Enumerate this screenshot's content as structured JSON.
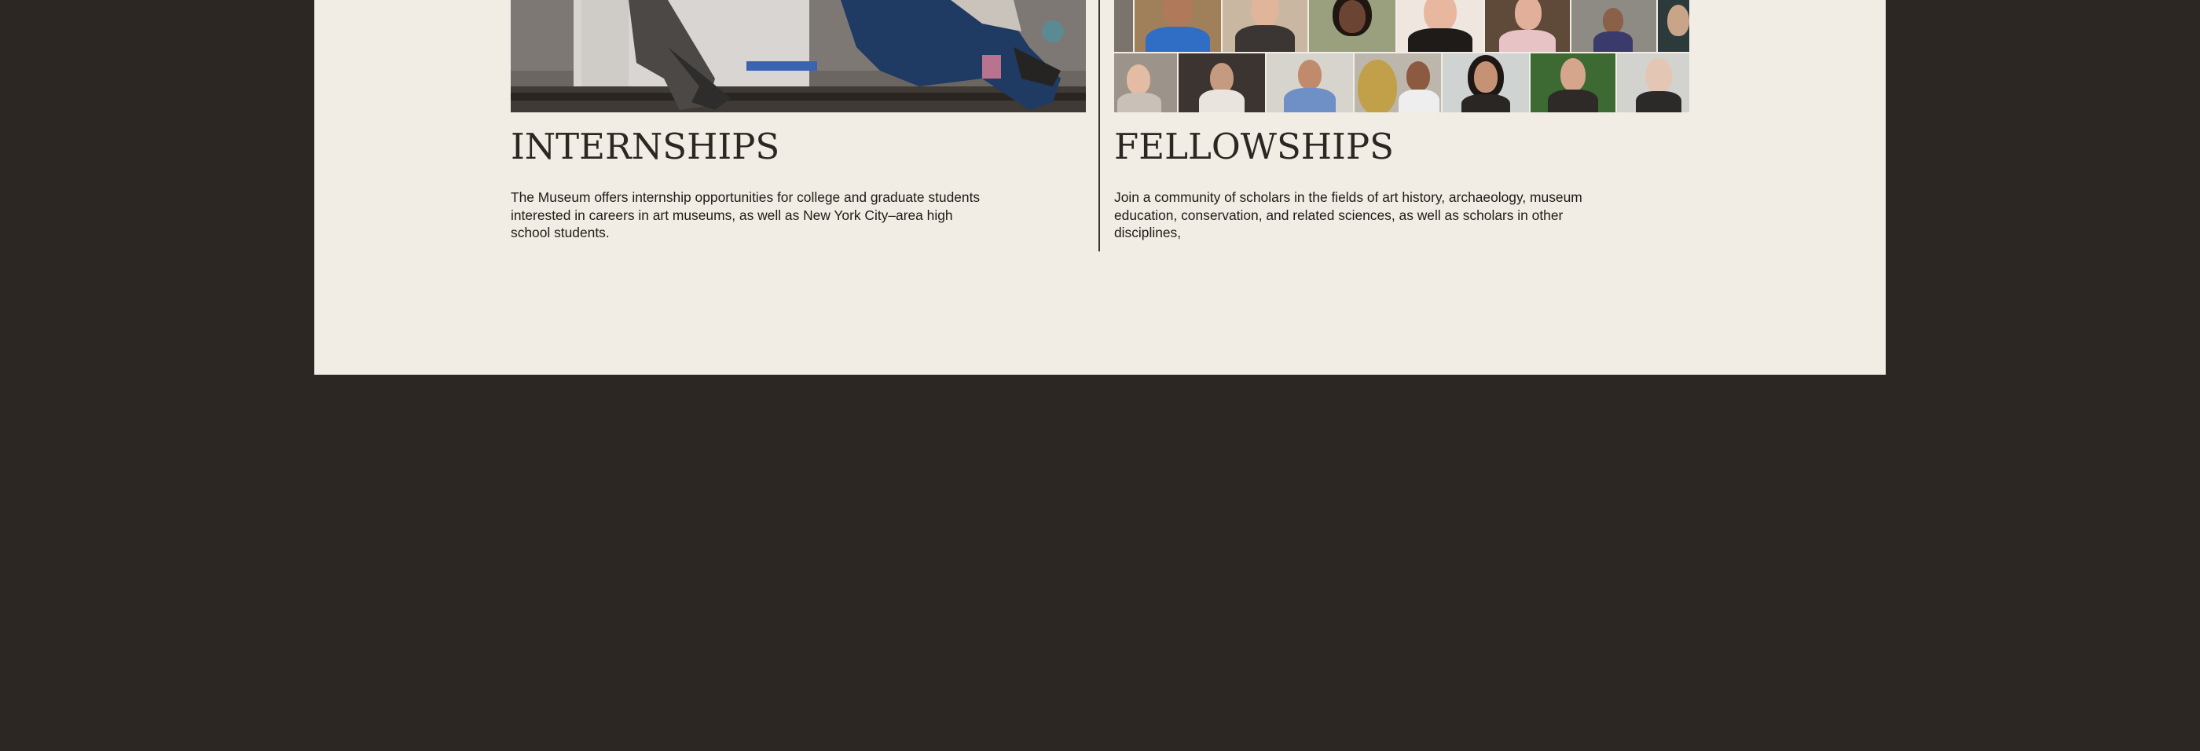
{
  "internships": {
    "title": "INTERNSHIPS",
    "description": "The Museum offers internship opportunities for college and graduate students interested in careers in art museums, as well as New York City–area high school students."
  },
  "fellowships": {
    "title": "FELLOWSHIPS",
    "description": "Join a community of scholars in the fields of art history, archaeology, museum education, conservation, and related sciences, as well as scholars in other disciplines,"
  },
  "colors": {
    "page_background": "#2c2723",
    "panel_background": "#f1ede5",
    "text": "#1f1b18"
  }
}
